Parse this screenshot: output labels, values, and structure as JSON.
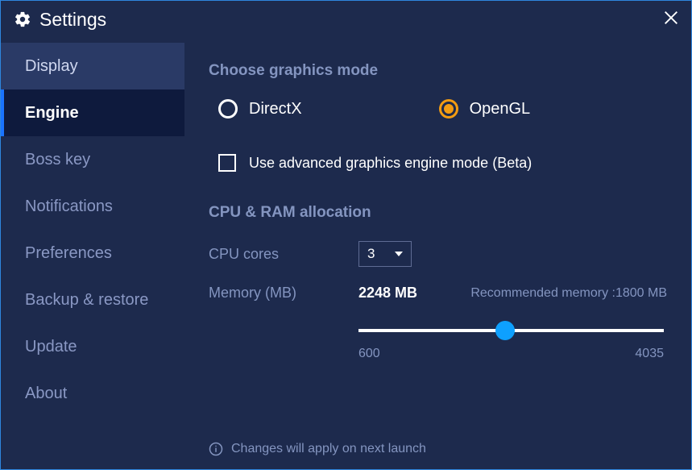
{
  "title": "Settings",
  "sidebar": {
    "items": [
      {
        "label": "Display"
      },
      {
        "label": "Engine"
      },
      {
        "label": "Boss key"
      },
      {
        "label": "Notifications"
      },
      {
        "label": "Preferences"
      },
      {
        "label": "Backup & restore"
      },
      {
        "label": "Update"
      },
      {
        "label": "About"
      }
    ]
  },
  "graphicsMode": {
    "heading": "Choose graphics mode",
    "options": [
      {
        "label": "DirectX",
        "selected": false
      },
      {
        "label": "OpenGL",
        "selected": true
      }
    ],
    "advancedCheckbox": "Use advanced graphics engine mode (Beta)"
  },
  "allocation": {
    "heading": "CPU & RAM allocation",
    "cpuCoresLabel": "CPU cores",
    "cpuCoresValue": "3",
    "memoryLabel": "Memory (MB)",
    "memoryValue": "2248 MB",
    "recommended": "Recommended memory :1800 MB",
    "slider": {
      "min": "600",
      "max": "4035",
      "value": 2248,
      "percent": 48
    }
  },
  "footerNote": "Changes will apply on next launch"
}
